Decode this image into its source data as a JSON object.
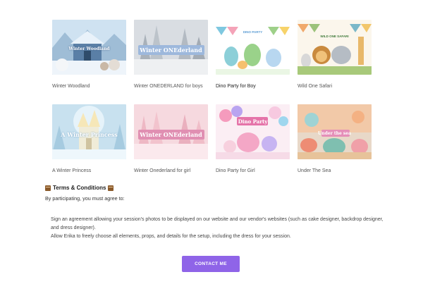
{
  "gallery": [
    {
      "title": "Winter Woodland",
      "overlay": "Winter Woodland",
      "bold": false
    },
    {
      "title": "Winter ONEDERLAND for boys",
      "overlay": "Winter ONEderland",
      "bold": false
    },
    {
      "title": "Dino Party for Boy",
      "overlay": "DINO PARTY",
      "bold": true
    },
    {
      "title": "Wild One Safari",
      "overlay": "WILD ONE SAFARI",
      "bold": false
    },
    {
      "title": "A Winter Princess",
      "overlay": "A Winter Princess",
      "bold": false
    },
    {
      "title": "Winter Onederland for girl",
      "overlay": "Winter ONEderland",
      "bold": false
    },
    {
      "title": "Dino Party for Girl",
      "overlay": "Dino Party",
      "bold": false
    },
    {
      "title": "Under The Sea",
      "overlay": "Under the sea",
      "bold": false
    }
  ],
  "terms": {
    "heading": "Terms & Conditions",
    "intro": "By participating, you must agree to:",
    "items": [
      "Sign an agreement allowing your session's photos to be displayed on our website and our vendor's websites (such as cake designer, backdrop designer, and dress designer).",
      "Allow Erika to freely choose all elements, props, and details for the setup, including the dress for your session."
    ]
  },
  "cta": {
    "label": "CONTACT ME"
  },
  "colors": {
    "button": "#8f64e8",
    "overlay_text": "#ffffff"
  }
}
